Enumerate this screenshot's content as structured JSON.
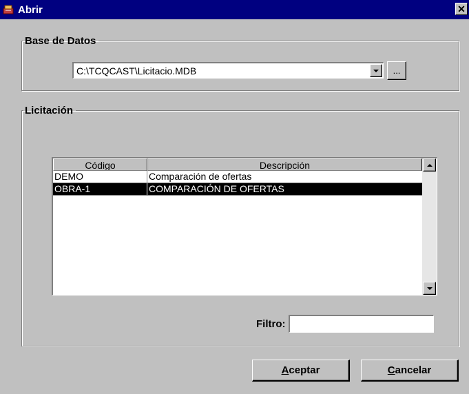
{
  "window": {
    "title": "Abrir",
    "icon": "app-icon",
    "close_glyph": "✕"
  },
  "database_group": {
    "legend": "Base de Datos",
    "path_value": "C:\\TCQCAST\\Licitacio.MDB",
    "browse_label": "..."
  },
  "licitacion_group": {
    "legend": "Licitación",
    "grid": {
      "columns": [
        "Código",
        "Descripción"
      ],
      "rows": [
        {
          "codigo": "DEMO",
          "descripcion": "Comparación de ofertas",
          "selected": false
        },
        {
          "codigo": "OBRA-1",
          "descripcion": "COMPARACIÓN DE OFERTAS",
          "selected": true
        }
      ]
    },
    "filter_label": "Filtro:",
    "filter_value": ""
  },
  "buttons": {
    "accept_accel": "A",
    "accept_rest": "ceptar",
    "cancel_accel": "C",
    "cancel_rest": "ancelar"
  },
  "colors": {
    "titlebar": "#000080",
    "face": "#c0c0c0",
    "selection": "#000000"
  }
}
